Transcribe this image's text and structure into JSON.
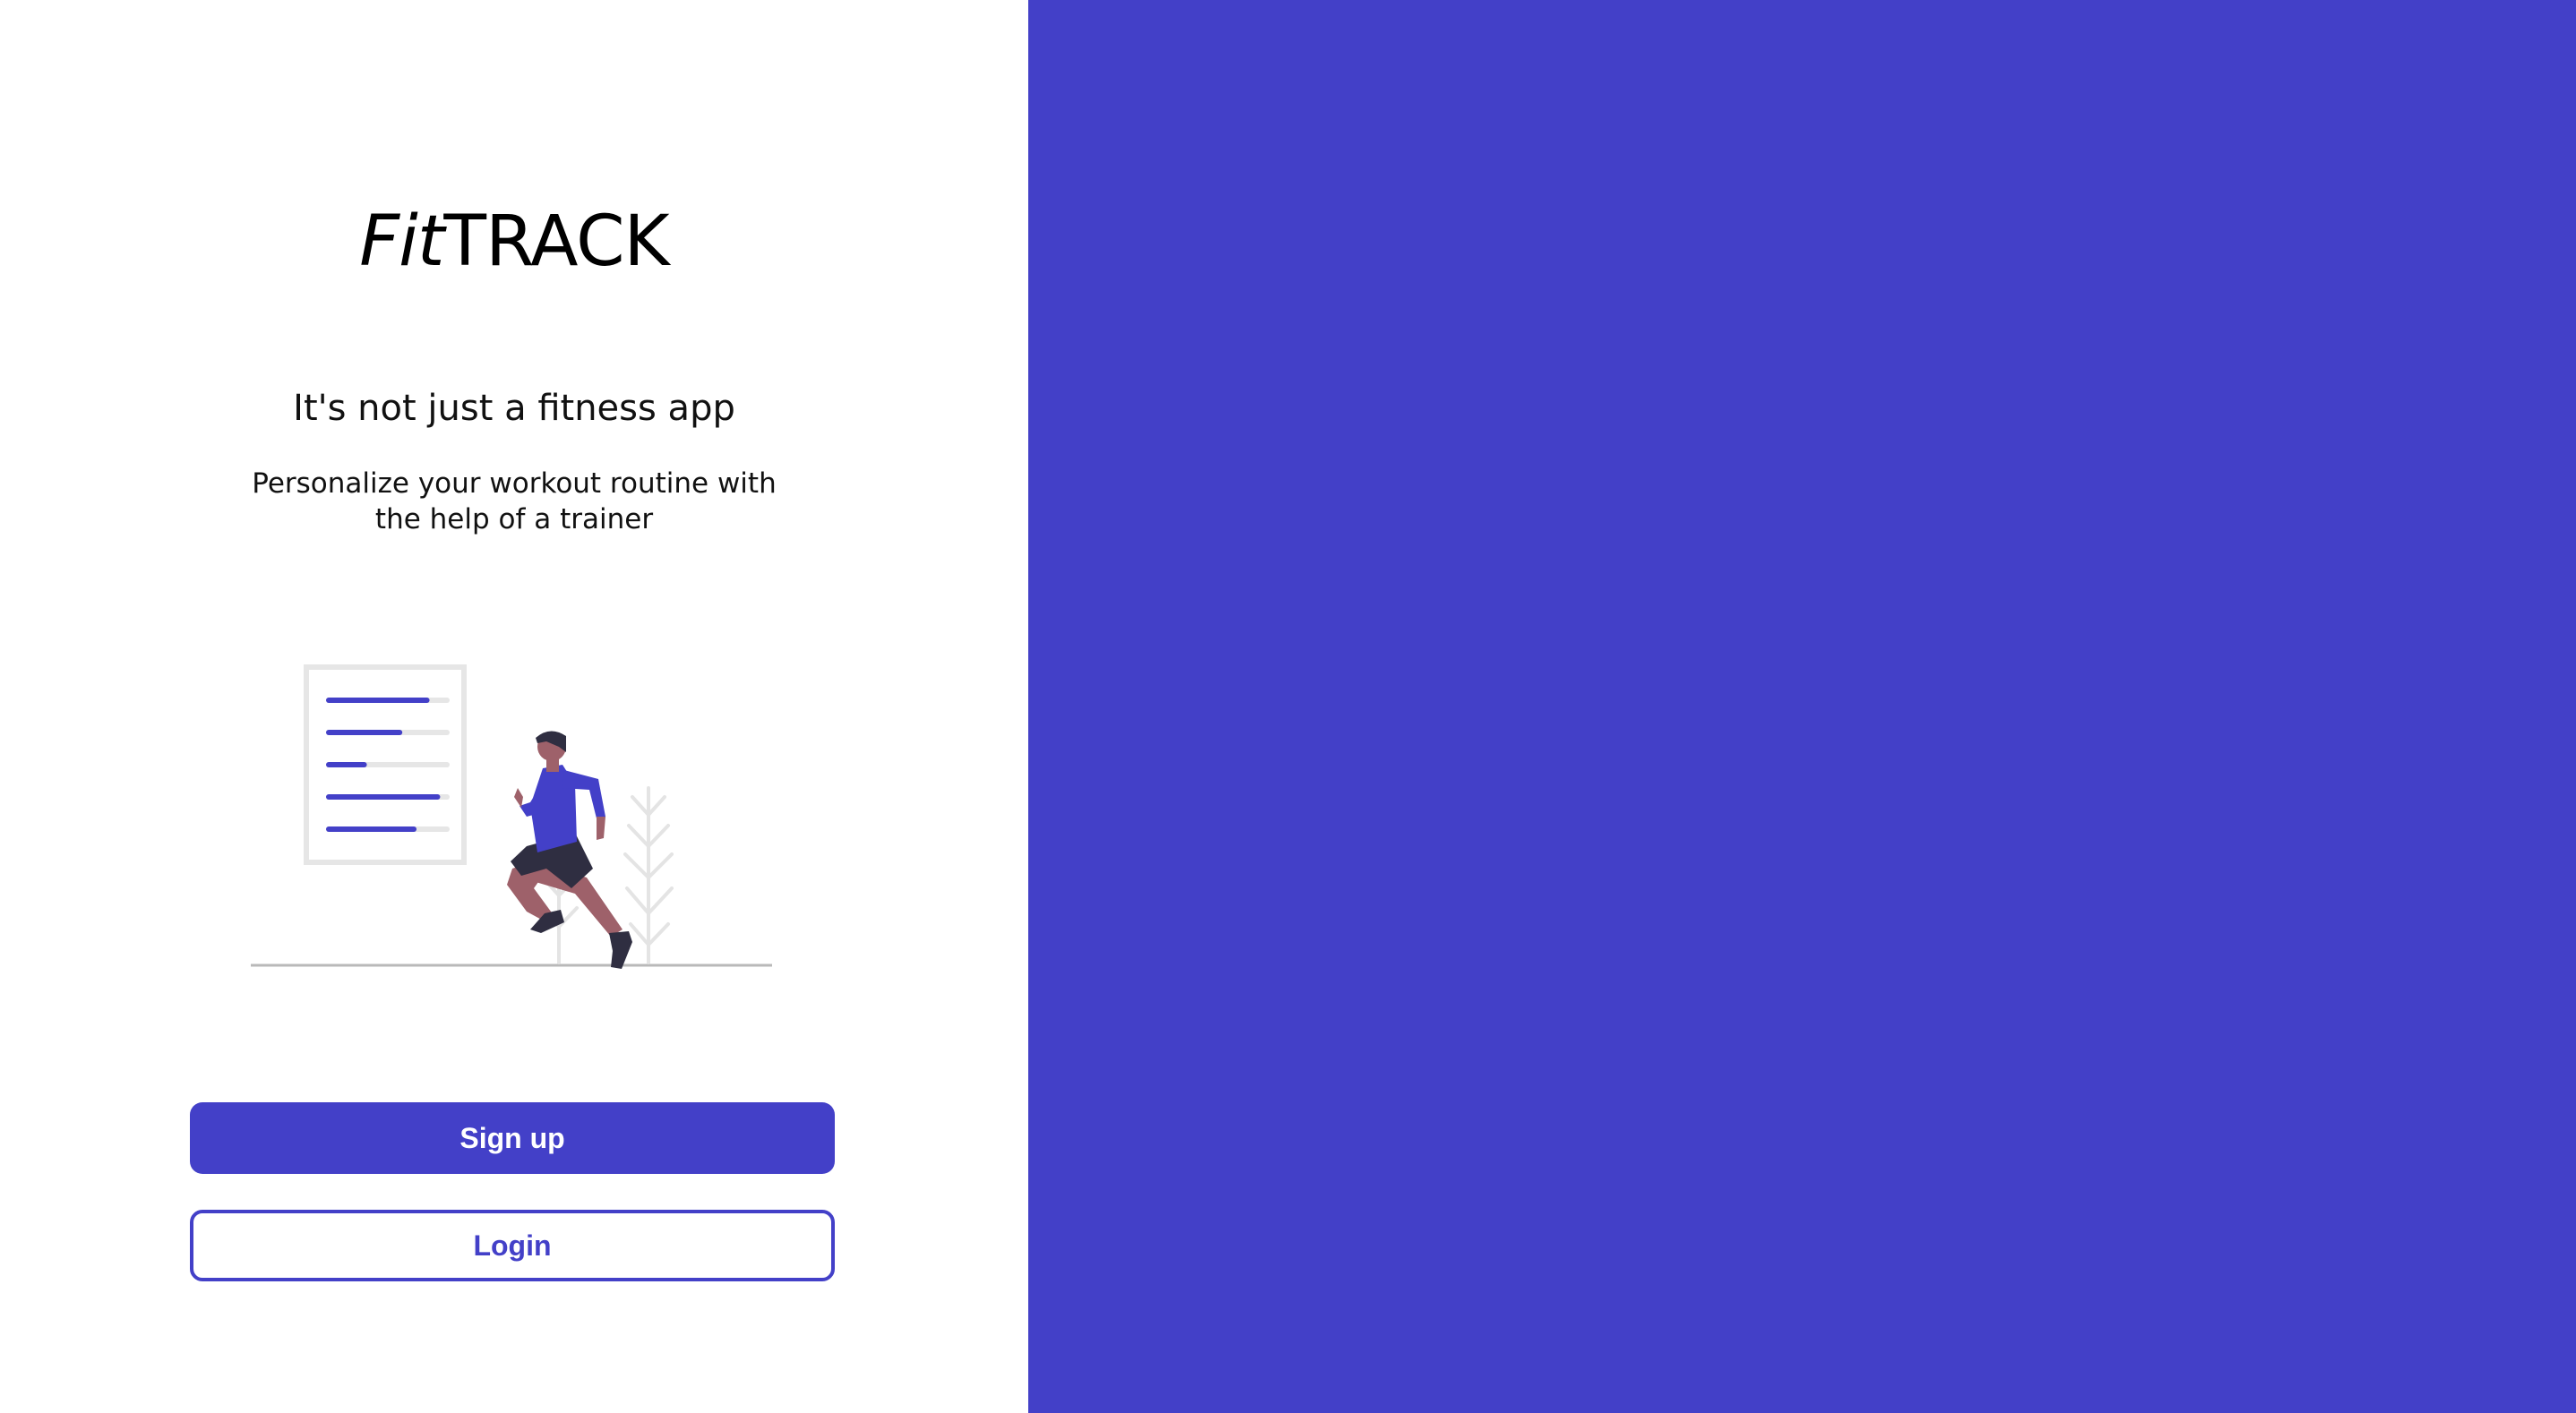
{
  "brand": {
    "logo_italic": "Fit",
    "logo_caps": "TRACK"
  },
  "hero": {
    "tagline": "It's not just a fitness app",
    "description": "Personalize your workout routine with the help of a trainer"
  },
  "illustration": {
    "icon": "runner-with-workout-plan-illustration",
    "progress_levels": [
      0.83,
      0.6,
      0.3,
      0.92,
      0.72
    ]
  },
  "actions": {
    "signup_label": "Sign up",
    "login_label": "Login"
  },
  "colors": {
    "accent": "#4340c8",
    "background": "#ffffff",
    "text": "#111111"
  }
}
